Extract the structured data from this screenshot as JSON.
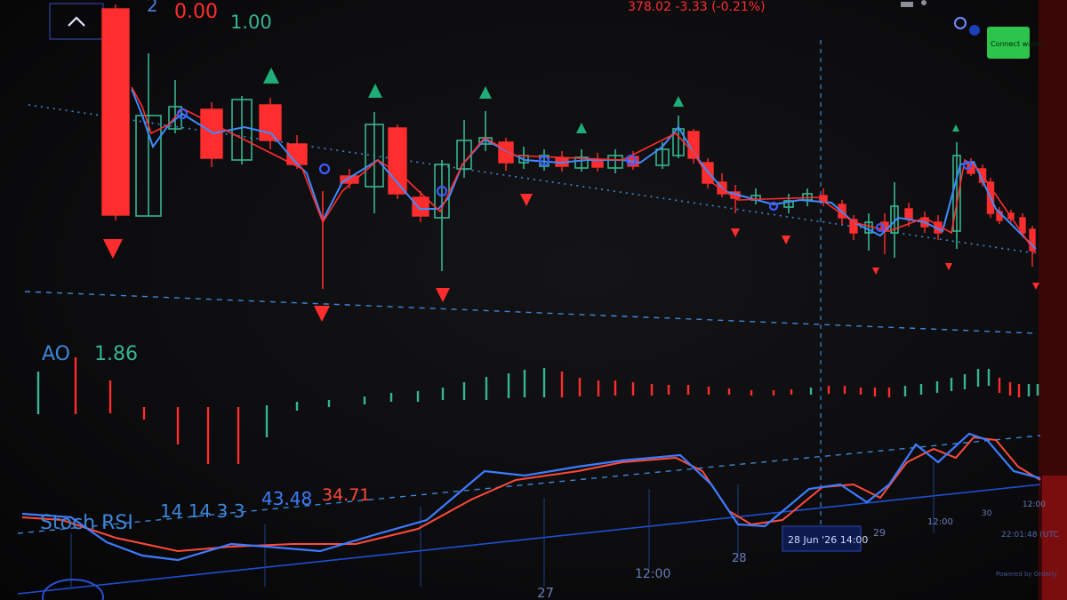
{
  "header": {
    "ohlc_fragment": "2",
    "change_red": "0.00",
    "change_green": "1.00",
    "price_line": "378.02  -3.33 (-0.21%)"
  },
  "top_right": {
    "connect_wallet_label": "Connect wallet"
  },
  "indicators": {
    "ao": {
      "label": "AO",
      "value": "1.86"
    },
    "stoch_rsi": {
      "label": "Stoch RSI",
      "params": "14 14 3 3",
      "k": "43.48",
      "d": "34.71"
    }
  },
  "time_axis": {
    "labels": [
      "27",
      "12:00",
      "28",
      "29",
      "12:00",
      "30",
      "12:00"
    ],
    "crosshair_label": "28 Jun '26  14:00",
    "clock": "22:01:48 (UTC"
  },
  "footer": {
    "powered_by": "Powered by Orderly"
  },
  "colors": {
    "up": "#36b58f",
    "down": "#ff2d2d",
    "ma_line": "#3d8bff",
    "dotted_blue": "#3c86d8",
    "stoch_k": "#3d7cff",
    "stoch_d": "#ff4a3a",
    "connect_wallet_bg": "#2cc44a"
  },
  "icons": {
    "collapse": "chevron-up-icon",
    "settings": "gear-icon",
    "info": "info-icon",
    "signal_up": "triangle-up-icon",
    "signal_down": "triangle-down-icon"
  }
}
